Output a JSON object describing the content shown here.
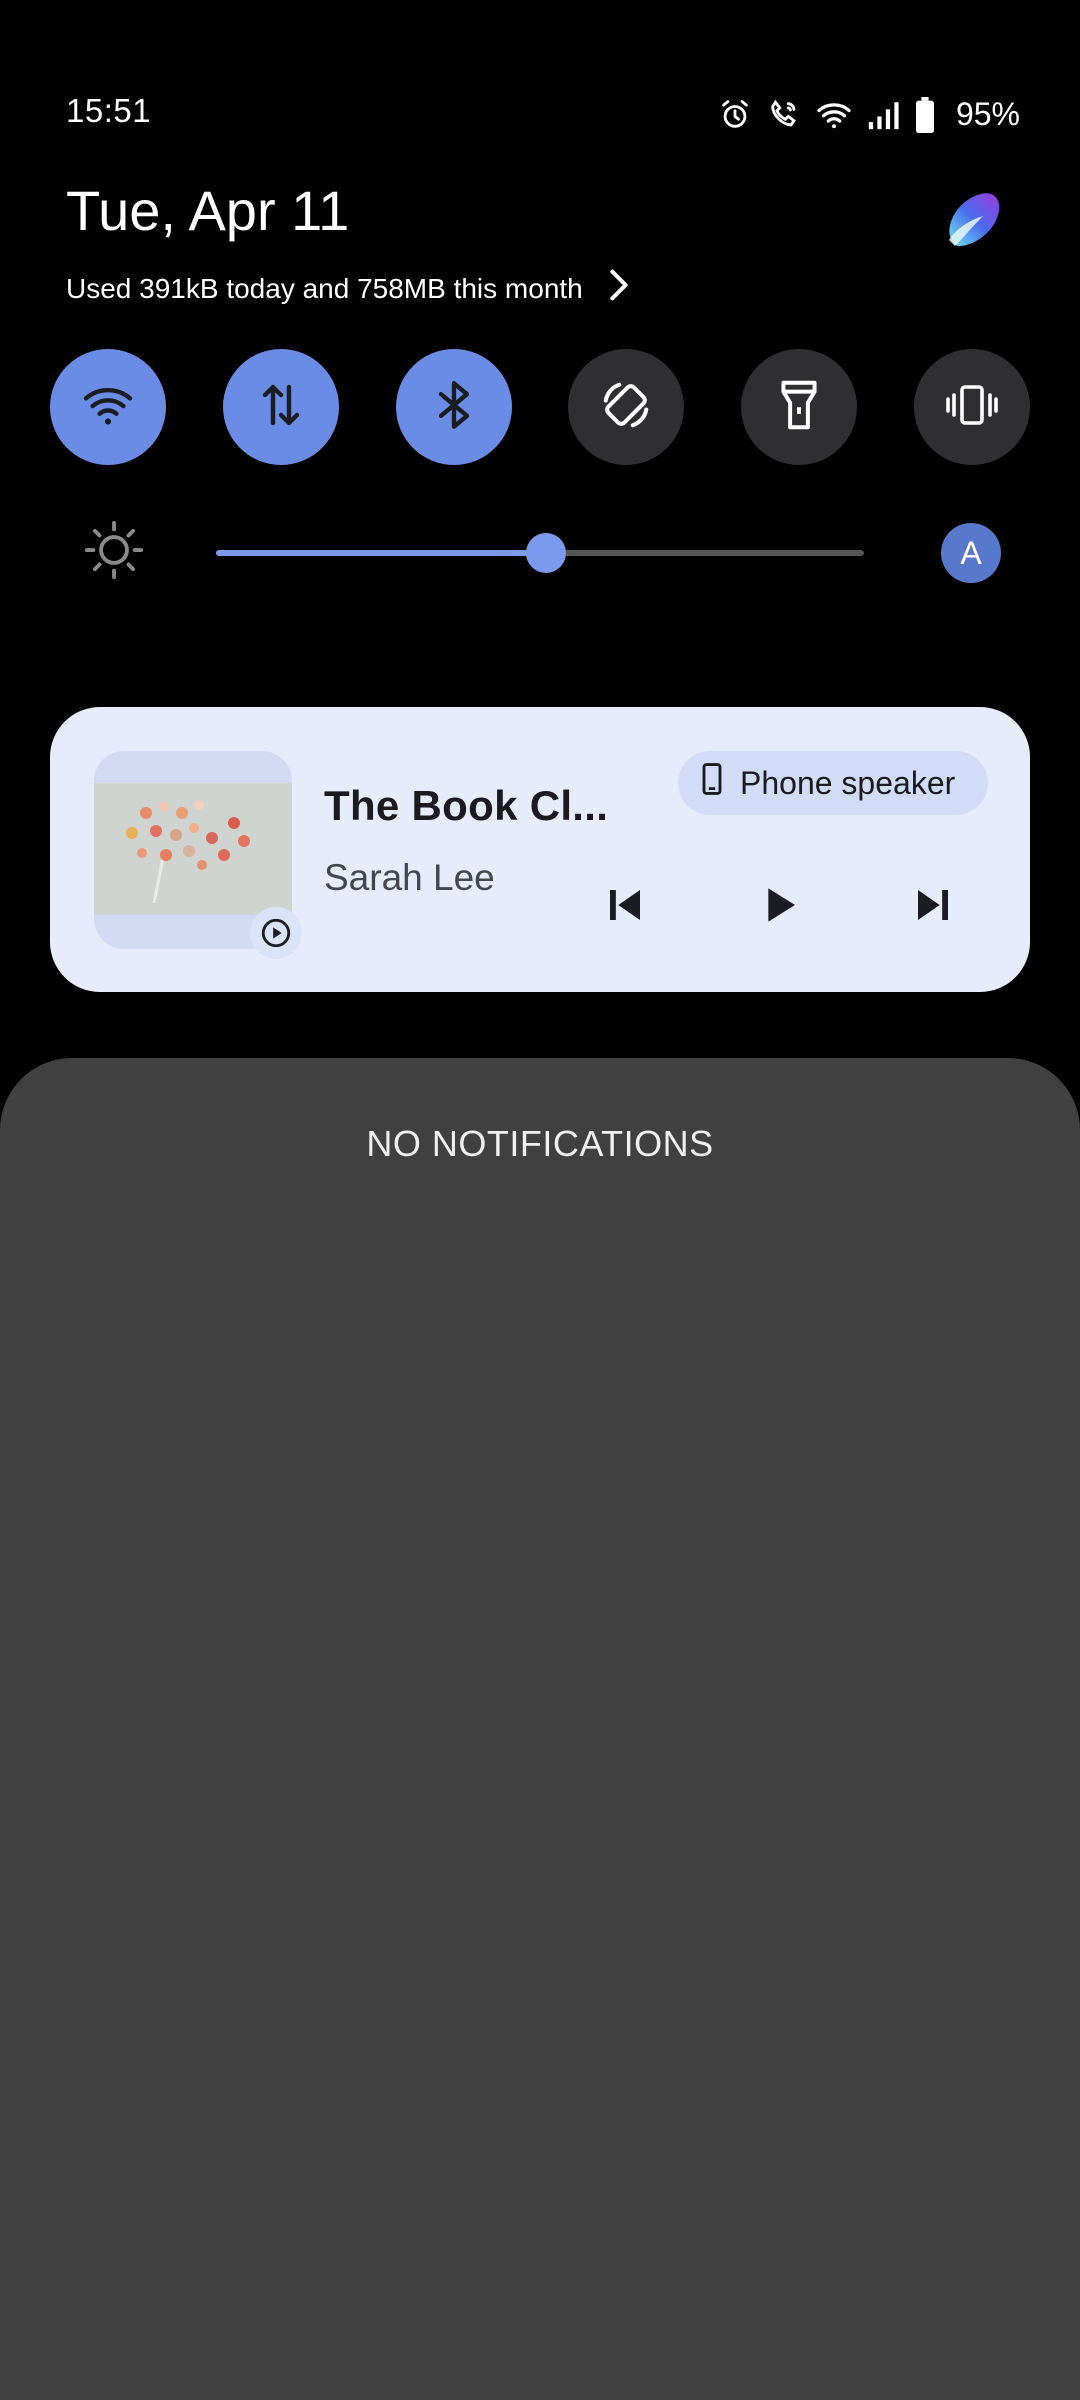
{
  "status": {
    "time": "15:51",
    "battery": "95%",
    "icons": [
      "alarm-icon",
      "wifi-calling-icon",
      "wifi-icon",
      "signal-icon",
      "battery-icon"
    ]
  },
  "header": {
    "date": "Tue, Apr 11",
    "data_usage": "Used 391kB today and 758MB this month"
  },
  "quick_tiles": [
    {
      "name": "wifi",
      "active": true
    },
    {
      "name": "mobile-data",
      "active": true
    },
    {
      "name": "bluetooth",
      "active": true
    },
    {
      "name": "auto-rotate",
      "active": false
    },
    {
      "name": "flashlight",
      "active": false
    },
    {
      "name": "vibrate",
      "active": false
    }
  ],
  "brightness": {
    "level_fraction": 0.51,
    "auto_label": "A"
  },
  "media": {
    "title": "The Book Cl...",
    "artist": "Sarah Lee",
    "output_device": "Phone speaker"
  },
  "notifications": {
    "empty_label": "NO NOTIFICATIONS"
  },
  "colors": {
    "accent": "#6a8ce4",
    "tile_off": "#2f2f32",
    "card_bg": "#e6ecfb",
    "panel_bg": "#404040"
  }
}
